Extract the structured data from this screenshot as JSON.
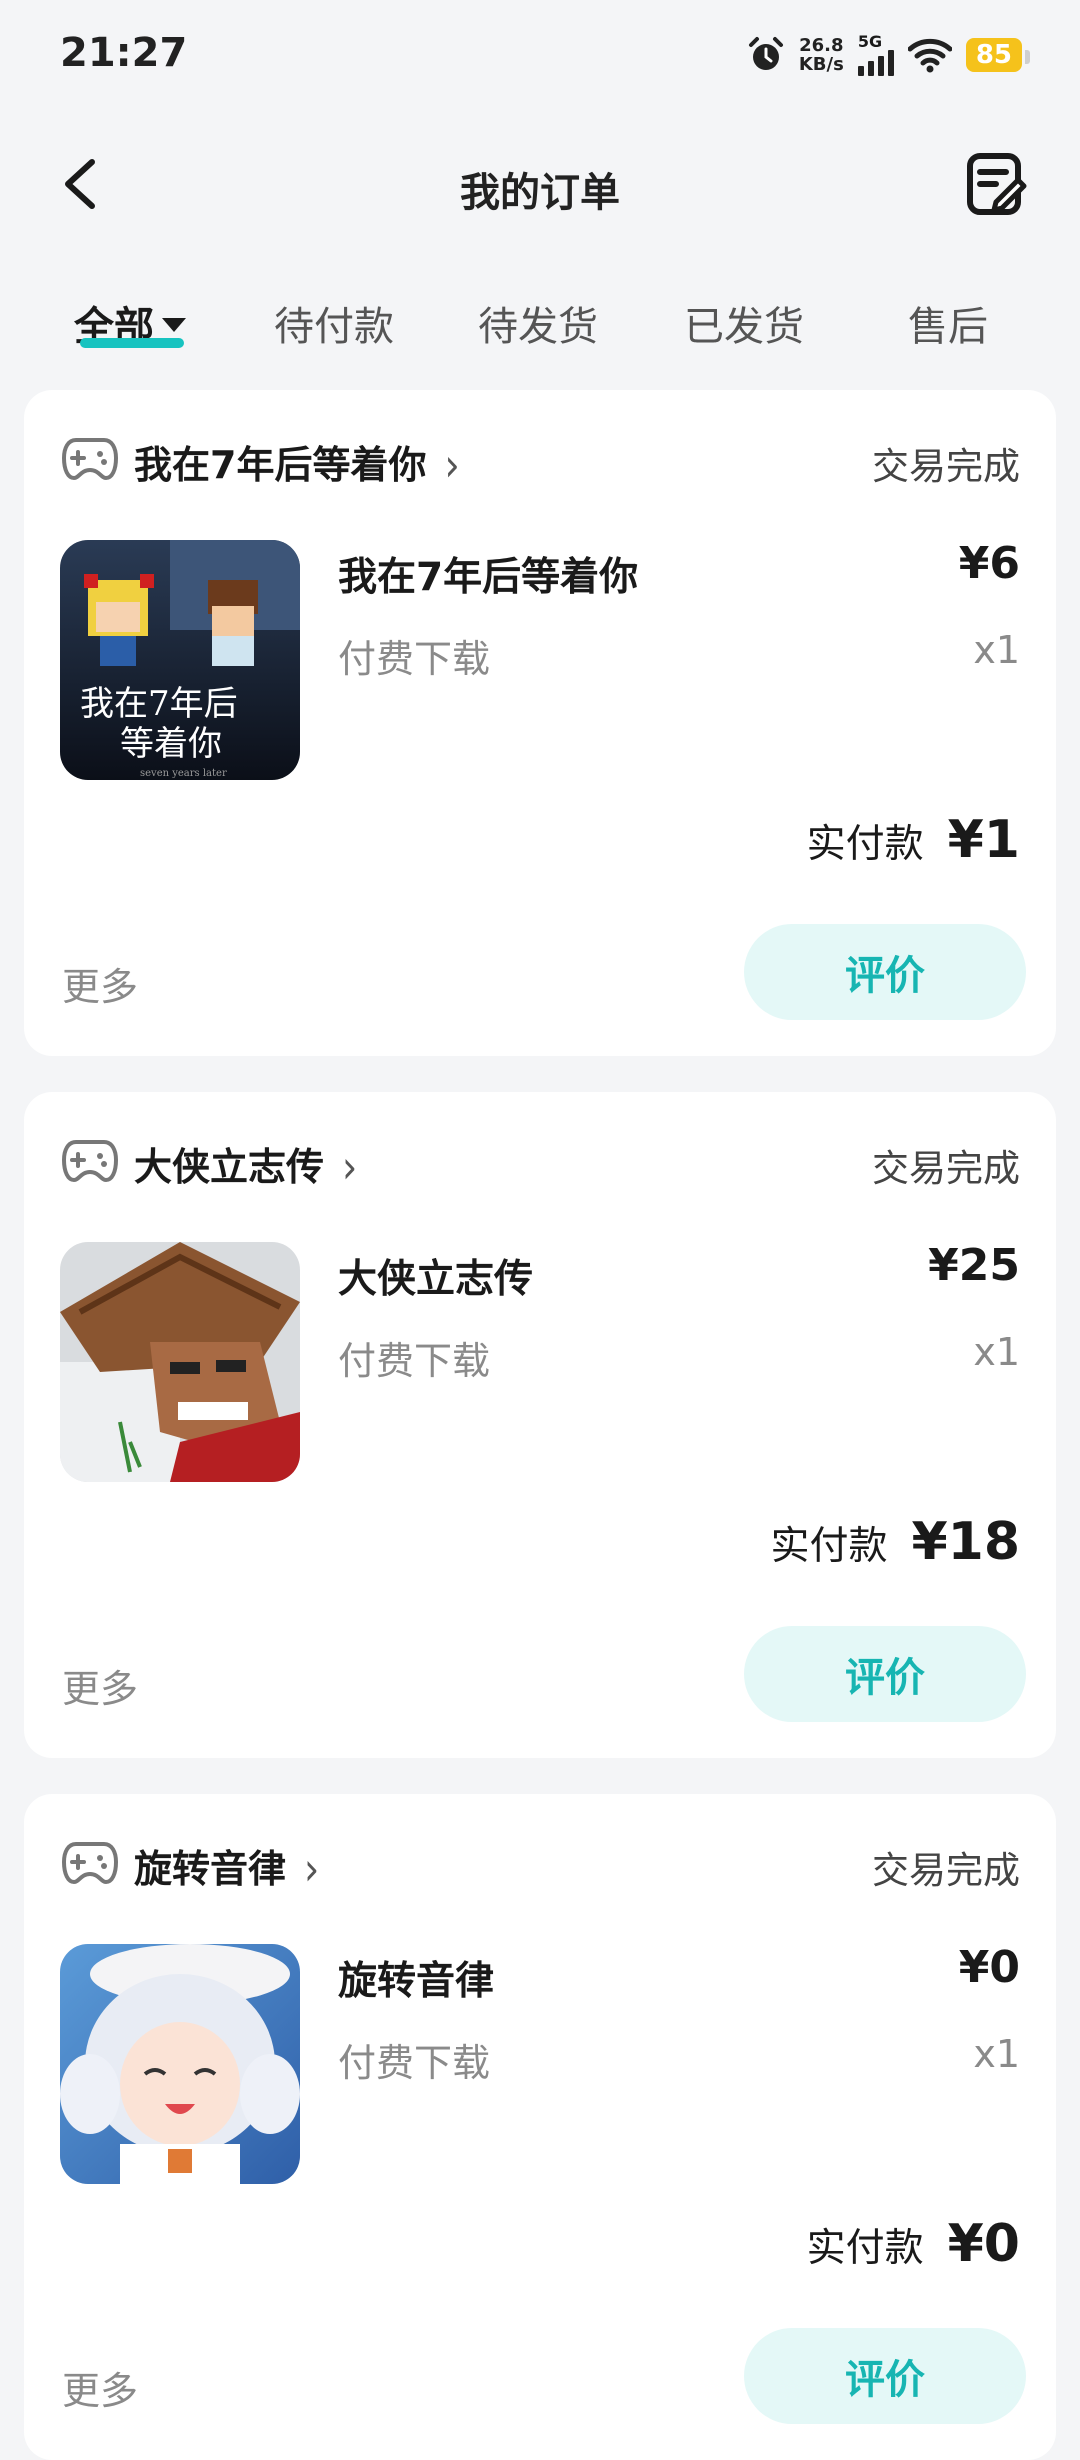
{
  "status_bar": {
    "time": "21:27",
    "net_speed_value": "26.8",
    "net_speed_unit": "KB/s",
    "network_type": "5G",
    "battery_level": "85",
    "icons": [
      "alarm-icon",
      "signal-icon",
      "wifi-icon",
      "battery-icon"
    ]
  },
  "header": {
    "title": "我的订单",
    "back_icon": "chevron-left-icon",
    "edit_icon": "edit-note-icon"
  },
  "tabs": [
    {
      "label": "全部",
      "active": true
    },
    {
      "label": "待付款",
      "active": false
    },
    {
      "label": "待发货",
      "active": false
    },
    {
      "label": "已发货",
      "active": false
    },
    {
      "label": "售后",
      "active": false
    }
  ],
  "orders": [
    {
      "shop_name": "我在7年后等着你",
      "status": "交易完成",
      "product_name": "我在7年后等着你",
      "product_type": "付费下载",
      "price": "¥6",
      "quantity": "x1",
      "paid_label": "实付款",
      "paid_amount": "¥1",
      "more_label": "更多",
      "action_label": "评价",
      "thumb_text_line1": "我在7年后",
      "thumb_text_line2": "等着你",
      "thumb_text_line3": "seven years later"
    },
    {
      "shop_name": "大侠立志传",
      "status": "交易完成",
      "product_name": "大侠立志传",
      "product_type": "付费下载",
      "price": "¥25",
      "quantity": "x1",
      "paid_label": "实付款",
      "paid_amount": "¥18",
      "more_label": "更多",
      "action_label": "评价"
    },
    {
      "shop_name": "旋转音律",
      "status": "交易完成",
      "product_name": "旋转音律",
      "product_type": "付费下载",
      "price": "¥0",
      "quantity": "x1",
      "paid_label": "实付款",
      "paid_amount": "¥0",
      "more_label": "更多",
      "action_label": "评价"
    }
  ],
  "colors": {
    "accent": "#17c3c0",
    "button_bg": "#e4f8f7",
    "button_text": "#17b5b2",
    "battery": "#f5c21b",
    "page_bg": "#f4f5f7"
  }
}
